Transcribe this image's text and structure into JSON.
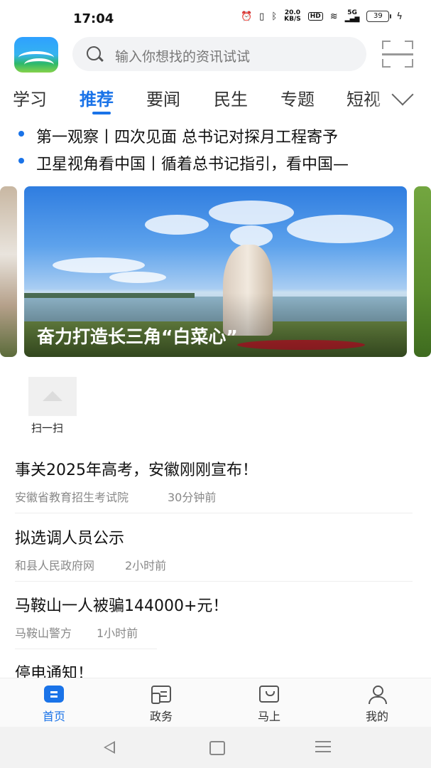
{
  "status_bar": {
    "time": "17:04",
    "net_speed_value": "20.0",
    "net_speed_unit": "KB/S",
    "hd_badge": "HD",
    "signal_label": "5G",
    "battery_level": "39",
    "icons": [
      "alarm-icon",
      "vibrate-icon",
      "bluetooth-icon",
      "hd-icon",
      "wifi-icon",
      "signal-icon",
      "battery-icon",
      "charging-icon"
    ]
  },
  "header": {
    "search_placeholder": "输入你想找的资讯试试",
    "icons": [
      "app-logo",
      "search-icon",
      "scan-icon"
    ]
  },
  "tabs": [
    {
      "label": "学习",
      "active": false
    },
    {
      "label": "推荐",
      "active": true
    },
    {
      "label": "要闻",
      "active": false
    },
    {
      "label": "民生",
      "active": false
    },
    {
      "label": "专题",
      "active": false
    },
    {
      "label": "短视",
      "active": false
    }
  ],
  "headlines": [
    "第一观察丨四次见面 总书记对探月工程寄予",
    "卫星视角看中国丨循着总书记指引，看中国—"
  ],
  "carousel": {
    "caption": "奋力打造长三角“白菜心”"
  },
  "quick_entry": {
    "label": "扫一扫"
  },
  "news": [
    {
      "title": "事关2025年高考，安徽刚刚宣布！",
      "source": "安徽省教育招生考试院",
      "time": "30分钟前"
    },
    {
      "title": "拟选调人员公示",
      "source": "和县人民政府网",
      "time": "2小时前"
    },
    {
      "title": "马鞍山一人被骗144000+元！",
      "source": "马鞍山警方",
      "time": "1小时前"
    },
    {
      "title": "停电通知！",
      "source": "",
      "time": ""
    }
  ],
  "bottom_nav": [
    {
      "label": "首页",
      "icon": "home-icon",
      "active": true
    },
    {
      "label": "政务",
      "icon": "government-icon",
      "active": false
    },
    {
      "label": "马上",
      "icon": "message-icon",
      "active": false
    },
    {
      "label": "我的",
      "icon": "profile-icon",
      "active": false
    }
  ],
  "system_nav": [
    "back-icon",
    "home-icon",
    "menu-icon"
  ],
  "colors": {
    "accent": "#1a73e8",
    "text_primary": "#111111",
    "text_secondary": "#888888",
    "search_bg": "#f2f3f5"
  }
}
